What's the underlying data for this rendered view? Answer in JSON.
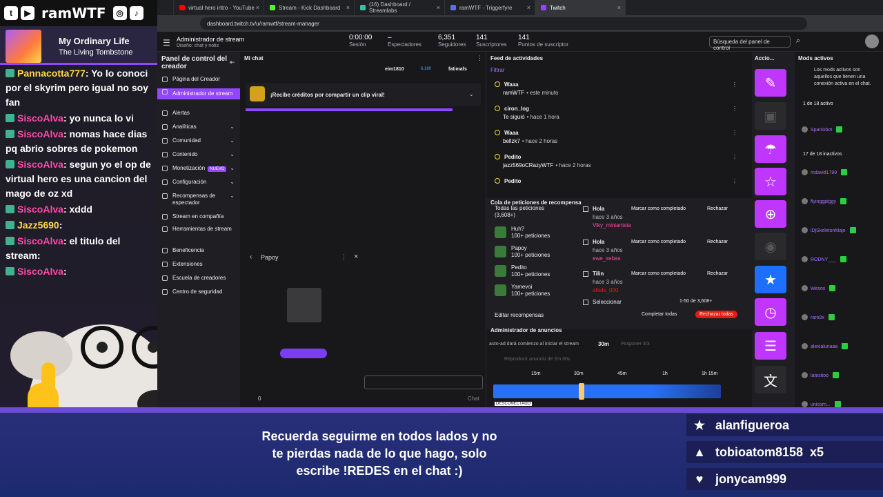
{
  "overlay": {
    "handle": "ramWTF",
    "now_playing": {
      "title": "My Ordinary Life",
      "artist": "The Living Tombstone"
    },
    "chat": [
      {
        "user": "Pannacotta777",
        "msg": ": Yo lo conoci por el skyrim pero igual no soy fan",
        "color": "yellow"
      },
      {
        "user": "SiscoAlva",
        "msg": ": yo nunca lo vi",
        "color": "pink"
      },
      {
        "user": "SiscoAlva",
        "msg": ": nomas hace dias pq abrio sobres de pokemon",
        "color": "pink"
      },
      {
        "user": "SiscoAlva",
        "msg": ": segun yo el op de virtual hero es una cancion del mago de oz xd",
        "color": "pink"
      },
      {
        "user": "SiscoAlva",
        "msg": ": xddd",
        "color": "pink"
      },
      {
        "user": "Jazz5690",
        "msg": ":",
        "color": "yellow"
      },
      {
        "user": "SiscoAlva",
        "msg": ": el titulo del stream:",
        "color": "pink"
      },
      {
        "user": "SiscoAlva",
        "msg": ":",
        "color": "pink"
      }
    ]
  },
  "browser": {
    "tabs": [
      {
        "label": "virtual hero intro - YouTube",
        "color": "#ff0000"
      },
      {
        "label": "Stream - Kick Dashboard",
        "color": "#53fc18"
      },
      {
        "label": "(16) Dashboard / Streamlabs",
        "color": "#31c3a2"
      },
      {
        "label": "ramWTF - Triggerfyre",
        "color": "#5b6cff"
      },
      {
        "label": "Twitch",
        "color": "#9146ff"
      }
    ],
    "url": "dashboard.twitch.tv/u/ramwtf/stream-manager"
  },
  "header": {
    "title": "Administrador de stream",
    "subtitle": "Diseño: chat y notis",
    "stats": [
      {
        "value": "0:00:00",
        "label": "Sesión"
      },
      {
        "value": "–",
        "label": "Espectadores"
      },
      {
        "value": "6,351",
        "label": "Seguidores"
      },
      {
        "value": "141",
        "label": "Suscriptores"
      },
      {
        "value": "141",
        "label": "Puntos de suscriptor"
      }
    ],
    "search_placeholder": "Búsqueda del panel de control"
  },
  "nav": {
    "title": "Panel de control del creador",
    "items": [
      {
        "label": "Página del Creador"
      },
      {
        "label": "Administrador de stream",
        "selected": true
      },
      {
        "label": "Alertas"
      },
      {
        "label": "Analíticas",
        "chev": true
      },
      {
        "label": "Comunidad",
        "chev": true
      },
      {
        "label": "Contenido",
        "chev": true
      },
      {
        "label": "Monetización",
        "chev": true,
        "badge": "NUEVO"
      },
      {
        "label": "Configuración",
        "chev": true
      },
      {
        "label": "Recompensas de espectador",
        "chev": true
      },
      {
        "label": "Stream en compañía"
      },
      {
        "label": "Herramientas de stream"
      },
      {
        "label": "Beneficencia"
      },
      {
        "label": "Extensiones"
      },
      {
        "label": "Escuela de creadores"
      },
      {
        "label": "Centro de seguridad"
      }
    ]
  },
  "mychat": {
    "title": "Mi chat",
    "users": [
      "eim1810",
      "6,160",
      "fatimafs"
    ],
    "viral": "¡Recibe créditos por compartir un clip viral!",
    "popup_title": "Papoy",
    "chat_label": "Chat",
    "points": "0"
  },
  "feed": {
    "title": "Feed de actividades",
    "filter": "Filtrar",
    "items": [
      {
        "name": "Waaa",
        "line2": "ramWTF",
        "time": "• este minuto"
      },
      {
        "name": "ciron_log",
        "line2": "Te siguió",
        "time": "• hace 1 hora"
      },
      {
        "name": "Waaa",
        "line2": "bellzk7",
        "time": "• hace 2 horas"
      },
      {
        "name": "Pedito",
        "line2": "jazz569oCRazyWTF",
        "time": "• hace 2 horas"
      },
      {
        "name": "Pedito",
        "line2": "",
        "time": ""
      }
    ],
    "queue_title": "Cola de peticiones de recompensa",
    "queue": [
      {
        "name": "Todas las peticiones",
        "count": "(3,608+)"
      },
      {
        "name": "Huh?",
        "count": "100+ peticiones"
      },
      {
        "name": "Papoy",
        "count": "100+ peticiones"
      },
      {
        "name": "Pedito",
        "count": "100+ peticiones"
      },
      {
        "name": "Yamevoi",
        "count": "100+ peticiones"
      }
    ],
    "requests": [
      {
        "title": "Hola",
        "time": "hace 3 años",
        "user": "Viky_miniartista"
      },
      {
        "title": "Hola",
        "time": "hace 3 años",
        "user": "ewe_sebas"
      },
      {
        "title": "Tilin",
        "time": "hace 3 años",
        "user": "afeds_000"
      }
    ],
    "mark_done": "Marcar como completado",
    "reject": "Rechazar",
    "select": "Seleccionar",
    "range": "1-50 de 3,608+",
    "complete_all": "Completar todas",
    "reject_all": "Rechazar todas",
    "edit_rewards": "Editar recompensas",
    "ads_title": "Administrador de anuncios",
    "ads_line": "auto-ad dará comienzo al iniciar el stream",
    "ads_time": "30m",
    "ads_postpone": "Posponer 3/3",
    "ads_play": "Reproducir anuncio de 2m 30s",
    "ticks": [
      "15m",
      "30m",
      "45m",
      "1h",
      "1h 15m"
    ],
    "disconnected": "DESCONECTADO"
  },
  "quick": {
    "title": "Accio..."
  },
  "mods": {
    "title": "Mods activos",
    "desc": "Los mods activos son aquellos que tienen una conexión activa en el chat.",
    "active": "1 de 18 activo",
    "inactive": "17 de 18 inactivos",
    "active_list": [
      "Spanixbot"
    ],
    "inactive_list": [
      "mdavid1799",
      "flyinggpiggy",
      "iDjSkeletonMajo",
      "RODNY___",
      "Wesos",
      "raro9x",
      "alexialunaaa",
      "latesitoo",
      "unicorn..."
    ]
  },
  "banner": {
    "message": "Recuerda seguirme en todos lados y no te pierdas nada de lo que hago, solo escribe !REDES en el chat :)",
    "supporters": [
      {
        "icon": "star-icon",
        "name": "alanfigueroa"
      },
      {
        "icon": "diamond-icon",
        "name": "tobioatom8158  x5"
      },
      {
        "icon": "heart-icon",
        "name": "jonycam999"
      }
    ]
  }
}
